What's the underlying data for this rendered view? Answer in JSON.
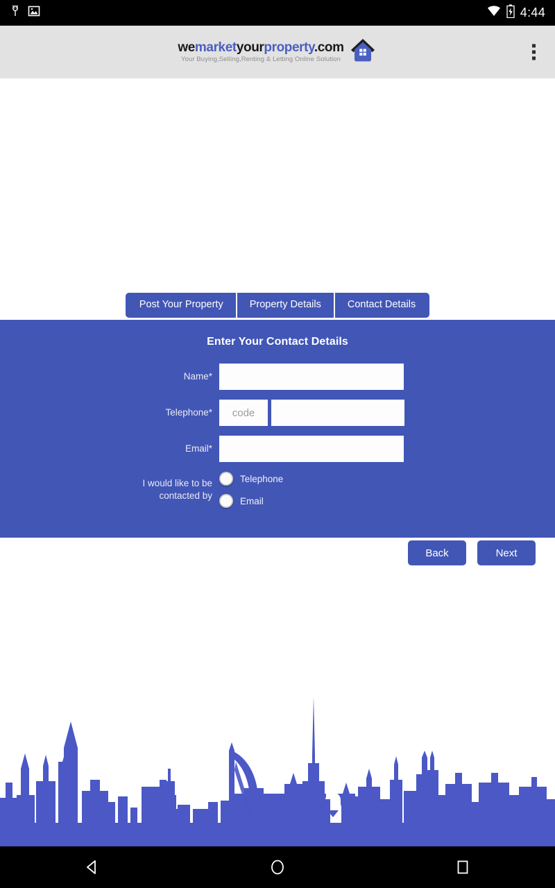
{
  "status_bar": {
    "time": "4:44",
    "icons": [
      "bug-report-icon",
      "image-icon",
      "wifi-icon",
      "battery-charging-icon"
    ]
  },
  "header": {
    "logo": {
      "part1": "we",
      "part2": "market",
      "part3": "your",
      "part4": "property",
      "part5": ".com",
      "tagline": "Your Buying,Selling,Renting & Letting Online Solution",
      "icon": "house-icon"
    },
    "overflow_menu": "more-options-icon"
  },
  "tabs": [
    {
      "label": "Post Your Property",
      "name": "tab-post-your-property",
      "active": false
    },
    {
      "label": "Property Details",
      "name": "tab-property-details",
      "active": false
    },
    {
      "label": "Contact Details",
      "name": "tab-contact-details",
      "active": true
    }
  ],
  "panel": {
    "title": "Enter Your Contact Details",
    "fields": {
      "name": {
        "label": "Name*",
        "value": "",
        "placeholder": ""
      },
      "telephone": {
        "label": "Telephone*",
        "code_value": "",
        "code_placeholder": "code",
        "number_value": "",
        "number_placeholder": ""
      },
      "email": {
        "label": "Email*",
        "value": "",
        "placeholder": ""
      }
    },
    "contact_preference": {
      "label": "I would like to be contacted by",
      "label_line1": "I would like to be",
      "label_line2": "contacted by",
      "options": [
        {
          "label": "Telephone",
          "selected": false
        },
        {
          "label": "Email",
          "selected": false
        }
      ]
    }
  },
  "actions": {
    "back_label": "Back",
    "next_label": "Next"
  },
  "nav_bar": {
    "back": "back-triangle-icon",
    "home": "home-circle-icon",
    "recents": "recents-square-icon"
  },
  "colors": {
    "brand_blue": "#4156b5",
    "skyline_blue": "#4b58c6",
    "header_gray": "#e2e2e2",
    "logo_blue": "#4a5fc1"
  }
}
